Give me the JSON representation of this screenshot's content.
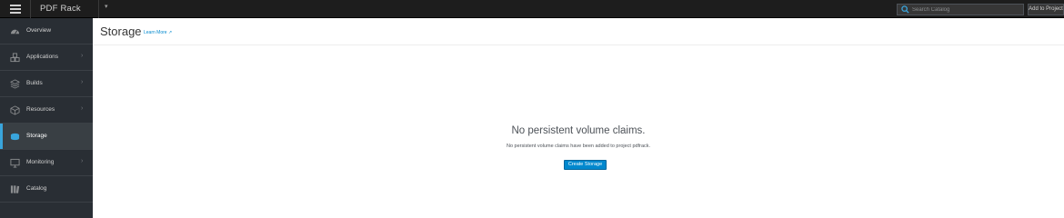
{
  "topbar": {
    "project_name": "PDF Rack",
    "search_placeholder": "Search Catalog",
    "add_to_project": "Add to Project"
  },
  "sidebar": {
    "items": [
      {
        "label": "Overview",
        "icon": "dashboard-icon",
        "has_chevron": false
      },
      {
        "label": "Applications",
        "icon": "cubes-icon",
        "has_chevron": true
      },
      {
        "label": "Builds",
        "icon": "layers-icon",
        "has_chevron": true
      },
      {
        "label": "Resources",
        "icon": "cube-icon",
        "has_chevron": true
      },
      {
        "label": "Storage",
        "icon": "database-icon",
        "has_chevron": false,
        "active": true
      },
      {
        "label": "Monitoring",
        "icon": "monitor-icon",
        "has_chevron": true
      },
      {
        "label": "Catalog",
        "icon": "books-icon",
        "has_chevron": false
      }
    ]
  },
  "page": {
    "title": "Storage",
    "learn_more": "Learn More"
  },
  "empty_state": {
    "title": "No persistent volume claims.",
    "description": "No persistent volume claims have been added to project pdfrack.",
    "button": "Create Storage"
  },
  "colors": {
    "topbar": "#1d1d1d",
    "sidebar": "#292e34",
    "active_indicator": "#39a5dc",
    "primary_button": "#0088ce"
  }
}
